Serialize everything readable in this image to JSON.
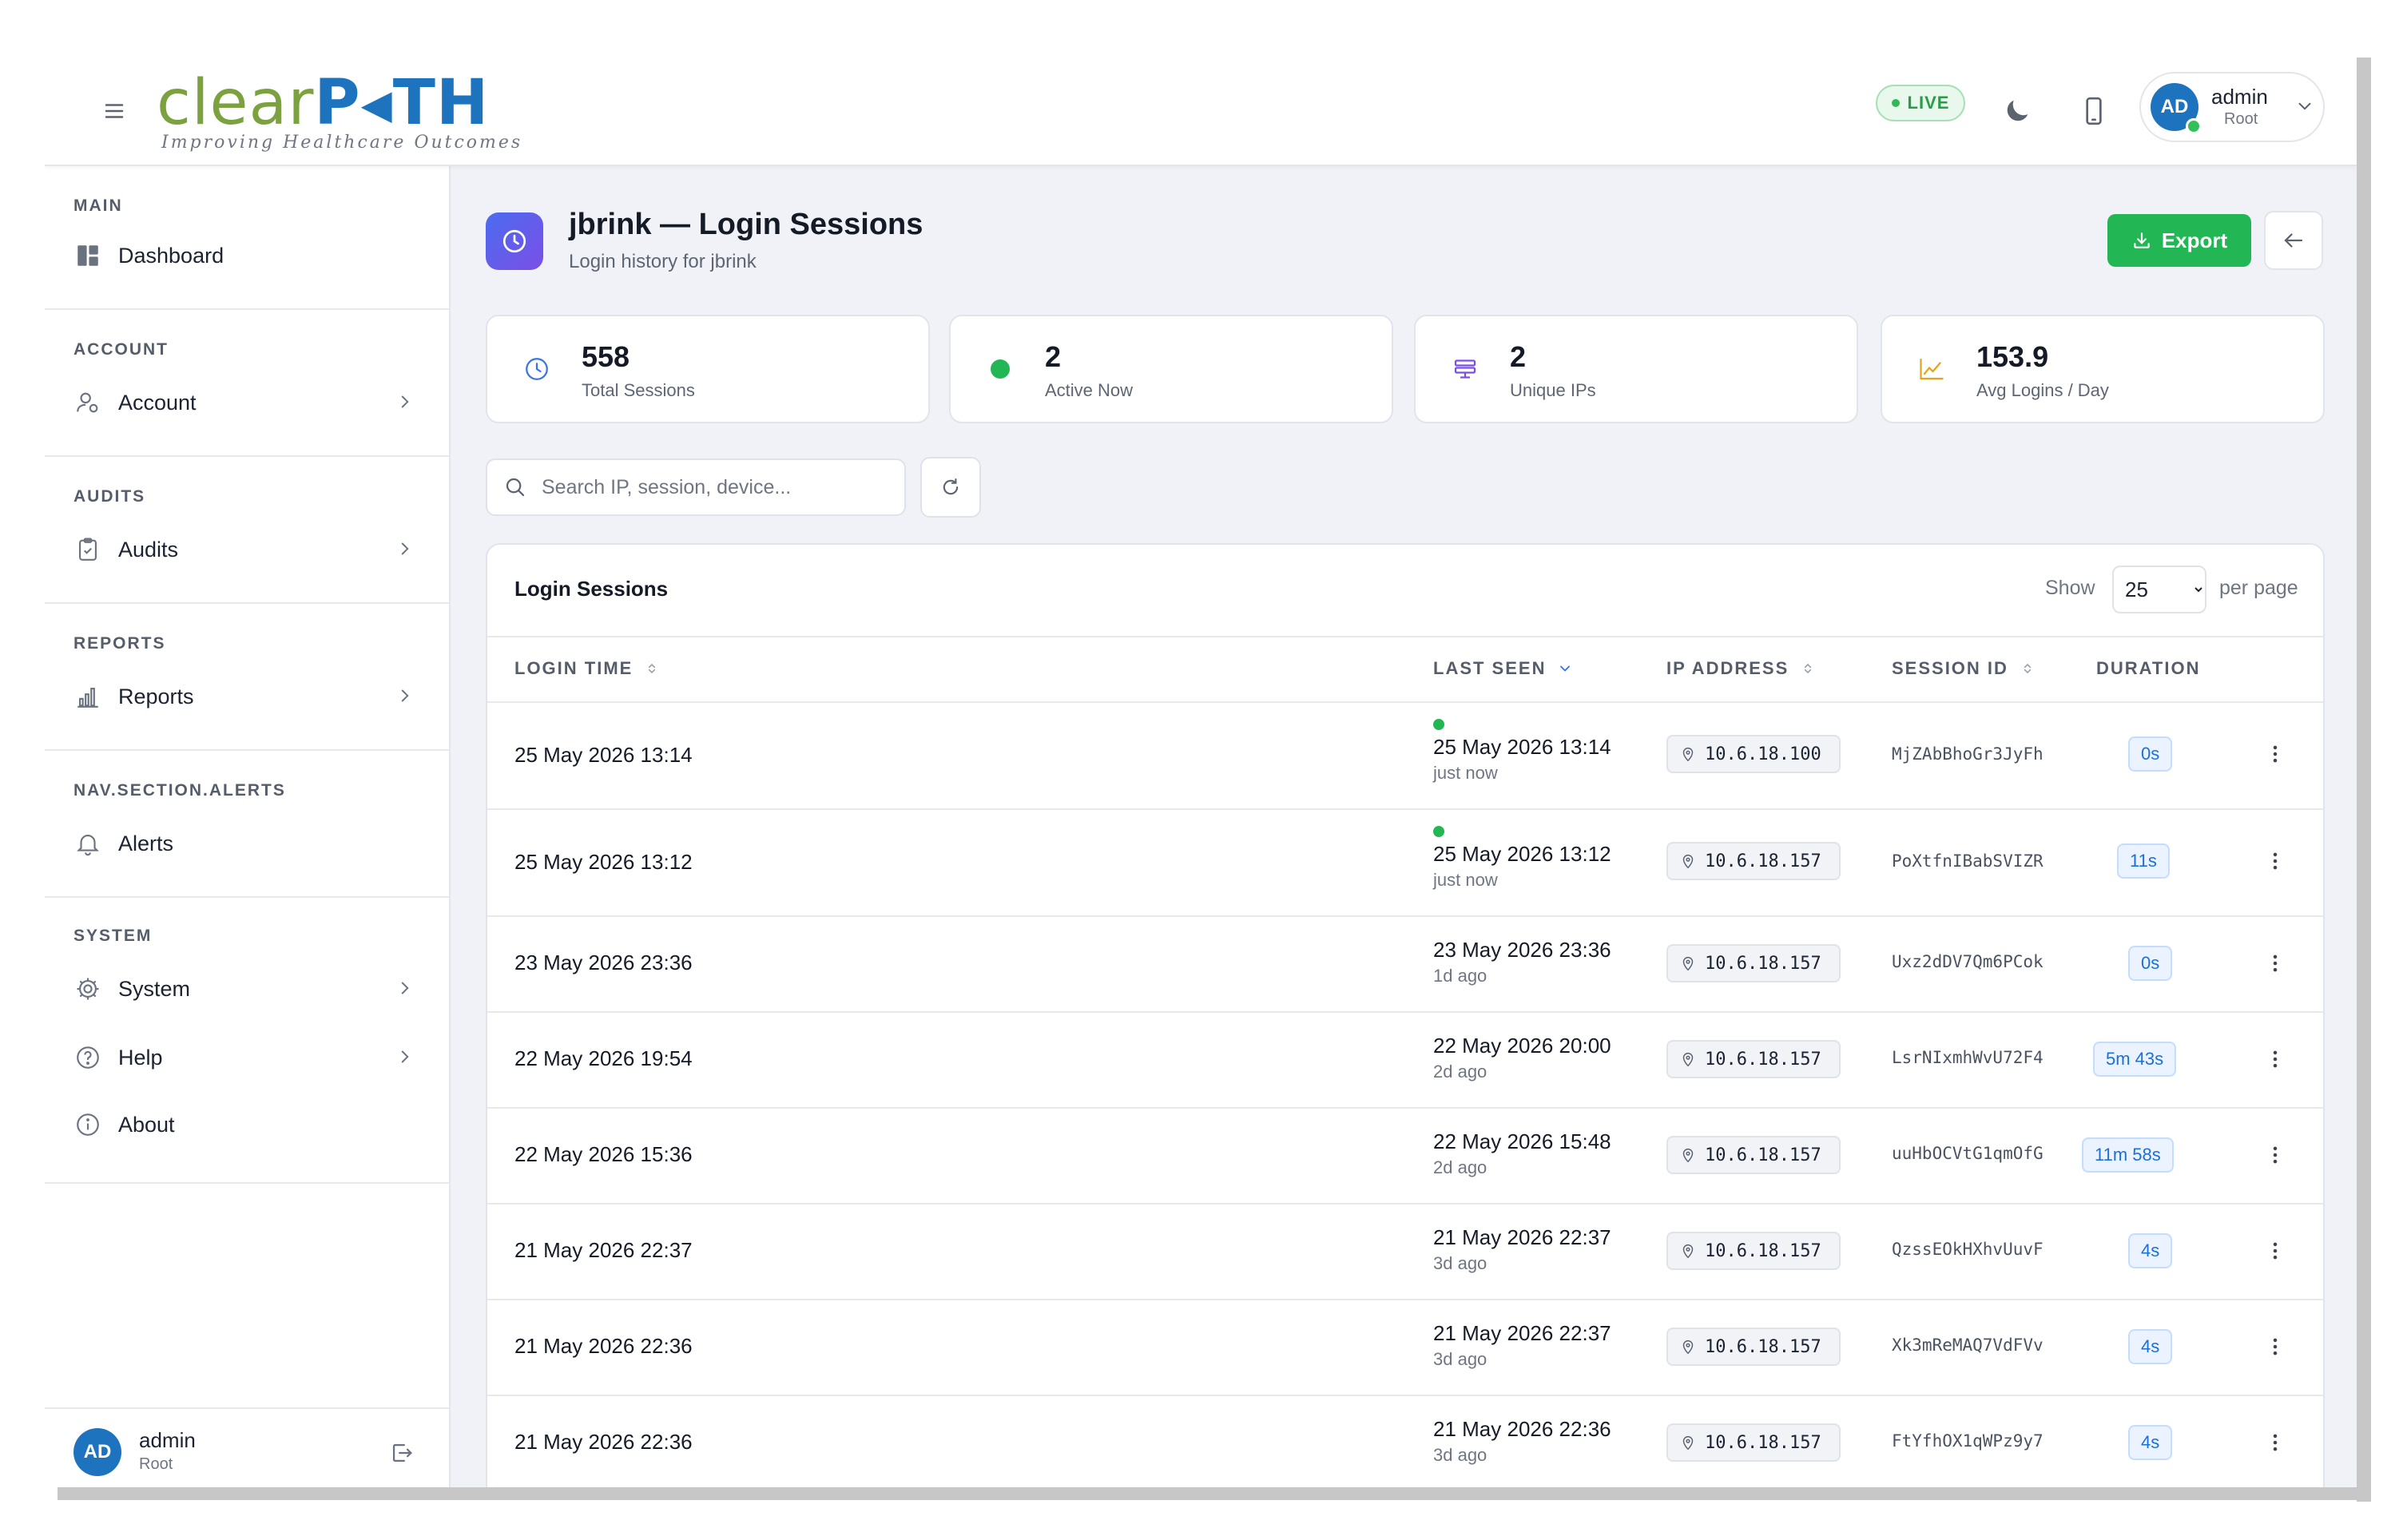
{
  "header": {
    "logo_part1": "clear",
    "logo_part2": "P◂TH",
    "logo_tagline": "Improving Healthcare Outcomes",
    "live_label": "LIVE",
    "user_name": "admin",
    "user_role": "Root",
    "avatar_initials": "AD"
  },
  "sidebar": {
    "sections": [
      {
        "title": "MAIN",
        "items": [
          {
            "label": "Dashboard",
            "icon": "dashboard-icon",
            "has_chevron": false
          }
        ]
      },
      {
        "title": "ACCOUNT",
        "items": [
          {
            "label": "Account",
            "icon": "user-icon",
            "has_chevron": true
          }
        ]
      },
      {
        "title": "AUDITS",
        "items": [
          {
            "label": "Audits",
            "icon": "clipboard-icon",
            "has_chevron": true
          }
        ]
      },
      {
        "title": "REPORTS",
        "items": [
          {
            "label": "Reports",
            "icon": "bar-chart-icon",
            "has_chevron": true
          }
        ]
      },
      {
        "title": "NAV.SECTION.ALERTS",
        "items": [
          {
            "label": "Alerts",
            "icon": "bell-icon",
            "has_chevron": false
          }
        ]
      },
      {
        "title": "SYSTEM",
        "items": [
          {
            "label": "System",
            "icon": "gear-icon",
            "has_chevron": true
          },
          {
            "label": "Help",
            "icon": "help-icon",
            "has_chevron": true
          },
          {
            "label": "About",
            "icon": "info-icon",
            "has_chevron": false
          }
        ]
      }
    ],
    "footer_user": {
      "name": "admin",
      "role": "Root",
      "initials": "AD"
    }
  },
  "page": {
    "title": "jbrink — Login Sessions",
    "subtitle": "Login history for jbrink",
    "export_label": "Export"
  },
  "stats": [
    {
      "value": "558",
      "label": "Total Sessions",
      "icon": "clock-icon"
    },
    {
      "value": "2",
      "label": "Active Now",
      "icon": "active-dot-icon"
    },
    {
      "value": "2",
      "label": "Unique IPs",
      "icon": "network-icon"
    },
    {
      "value": "153.9",
      "label": "Avg Logins / Day",
      "icon": "line-chart-icon"
    }
  ],
  "search": {
    "placeholder": "Search IP, session, device..."
  },
  "table": {
    "title": "Login Sessions",
    "show_label": "Show",
    "per_page_value": "25",
    "per_page_label": "per page",
    "columns": [
      "LOGIN TIME",
      "LAST SEEN",
      "IP ADDRESS",
      "SESSION ID",
      "DURATION"
    ],
    "rows": [
      {
        "login": "25 May 2026 13:14",
        "last_seen": "25 May 2026 13:14",
        "relative": "just now",
        "active": true,
        "ip": "10.6.18.100",
        "session": "MjZAbBhoGr3JyFh",
        "duration": "0s"
      },
      {
        "login": "25 May 2026 13:12",
        "last_seen": "25 May 2026 13:12",
        "relative": "just now",
        "active": true,
        "ip": "10.6.18.157",
        "session": "PoXtfnIBabSVIZR",
        "duration": "11s"
      },
      {
        "login": "23 May 2026 23:36",
        "last_seen": "23 May 2026 23:36",
        "relative": "1d ago",
        "active": false,
        "ip": "10.6.18.157",
        "session": "Uxz2dDV7Qm6PCok",
        "duration": "0s"
      },
      {
        "login": "22 May 2026 19:54",
        "last_seen": "22 May 2026 20:00",
        "relative": "2d ago",
        "active": false,
        "ip": "10.6.18.157",
        "session": "LsrNIxmhWvU72F4",
        "duration": "5m 43s"
      },
      {
        "login": "22 May 2026 15:36",
        "last_seen": "22 May 2026 15:48",
        "relative": "2d ago",
        "active": false,
        "ip": "10.6.18.157",
        "session": "uuHbOCVtG1qmOfG",
        "duration": "11m 58s"
      },
      {
        "login": "21 May 2026 22:37",
        "last_seen": "21 May 2026 22:37",
        "relative": "3d ago",
        "active": false,
        "ip": "10.6.18.157",
        "session": "QzssEOkHXhvUuvF",
        "duration": "4s"
      },
      {
        "login": "21 May 2026 22:36",
        "last_seen": "21 May 2026 22:37",
        "relative": "3d ago",
        "active": false,
        "ip": "10.6.18.157",
        "session": "Xk3mReMAQ7VdFVv",
        "duration": "4s"
      },
      {
        "login": "21 May 2026 22:36",
        "last_seen": "21 May 2026 22:36",
        "relative": "3d ago",
        "active": false,
        "ip": "10.6.18.157",
        "session": "FtYfhOX1qWPz9y7",
        "duration": "4s"
      }
    ]
  },
  "colors": {
    "brand_blue": "#1d73bd",
    "brand_green": "#7ba23f",
    "export_green": "#22b754",
    "duration_blue": "#1d6fd8"
  }
}
